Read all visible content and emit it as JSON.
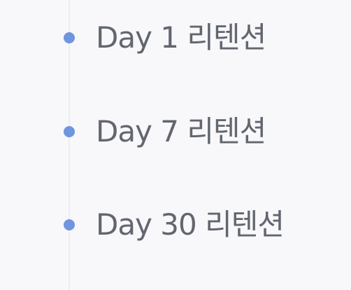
{
  "items": [
    {
      "label": "Day 1 리텐션"
    },
    {
      "label": "Day 7 리텐션"
    },
    {
      "label": "Day 30 리텐션"
    }
  ],
  "colors": {
    "bullet": "#6f95de",
    "text": "#62666f",
    "background": "#f8f8fb",
    "rail": "#eceef3"
  }
}
